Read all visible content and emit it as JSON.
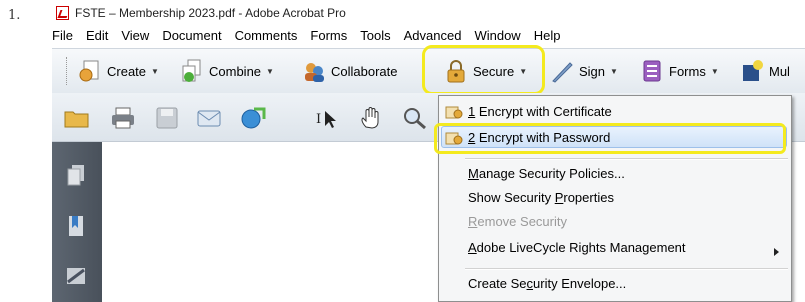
{
  "step_number": "1.",
  "window_title": "FSTE – Membership 2023.pdf - Adobe Acrobat Pro",
  "menubar": [
    "File",
    "Edit",
    "View",
    "Document",
    "Comments",
    "Forms",
    "Tools",
    "Advanced",
    "Window",
    "Help"
  ],
  "toolbar": {
    "create": "Create",
    "combine": "Combine",
    "collaborate": "Collaborate",
    "secure": "Secure",
    "sign": "Sign",
    "forms": "Forms",
    "multimedia": "Mul"
  },
  "secure_menu": {
    "items": [
      {
        "label": "1 Encrypt with Certificate",
        "mnemonic": "1"
      },
      {
        "label": "2 Encrypt with Password",
        "mnemonic": "2"
      },
      {
        "label": "Manage Security Policies...",
        "mnemonic": "M"
      },
      {
        "label": "Show Security Properties",
        "mnemonic": "P"
      },
      {
        "label": "Remove Security",
        "mnemonic": "R",
        "disabled": true
      },
      {
        "label": "Adobe LiveCycle Rights Management",
        "mnemonic": "A"
      },
      {
        "label": "Create Security Envelope...",
        "mnemonic": "c"
      }
    ]
  },
  "colors": {
    "highlight_yellow": "#f4ea1e",
    "sidebar": "#525a64",
    "menu_bg": "#f5f6f7",
    "hover_blue": "#cfe2f8"
  }
}
